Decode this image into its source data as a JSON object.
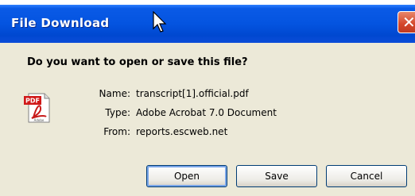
{
  "window": {
    "title": "File Download"
  },
  "dialog": {
    "question": "Do you want to open or save this file?",
    "file_icon": "pdf-document-icon",
    "fields": [
      {
        "label": "Name:",
        "value": "transcript[1].official.pdf"
      },
      {
        "label": "Type:",
        "value": "Adobe Acrobat 7.0 Document"
      },
      {
        "label": "From:",
        "value": "reports.escweb.net"
      }
    ]
  },
  "buttons": {
    "open": "Open",
    "save": "Save",
    "cancel": "Cancel"
  },
  "colors": {
    "titlebar": "#0454e0",
    "close": "#d4462a",
    "window_bg": "#ece9d8"
  }
}
